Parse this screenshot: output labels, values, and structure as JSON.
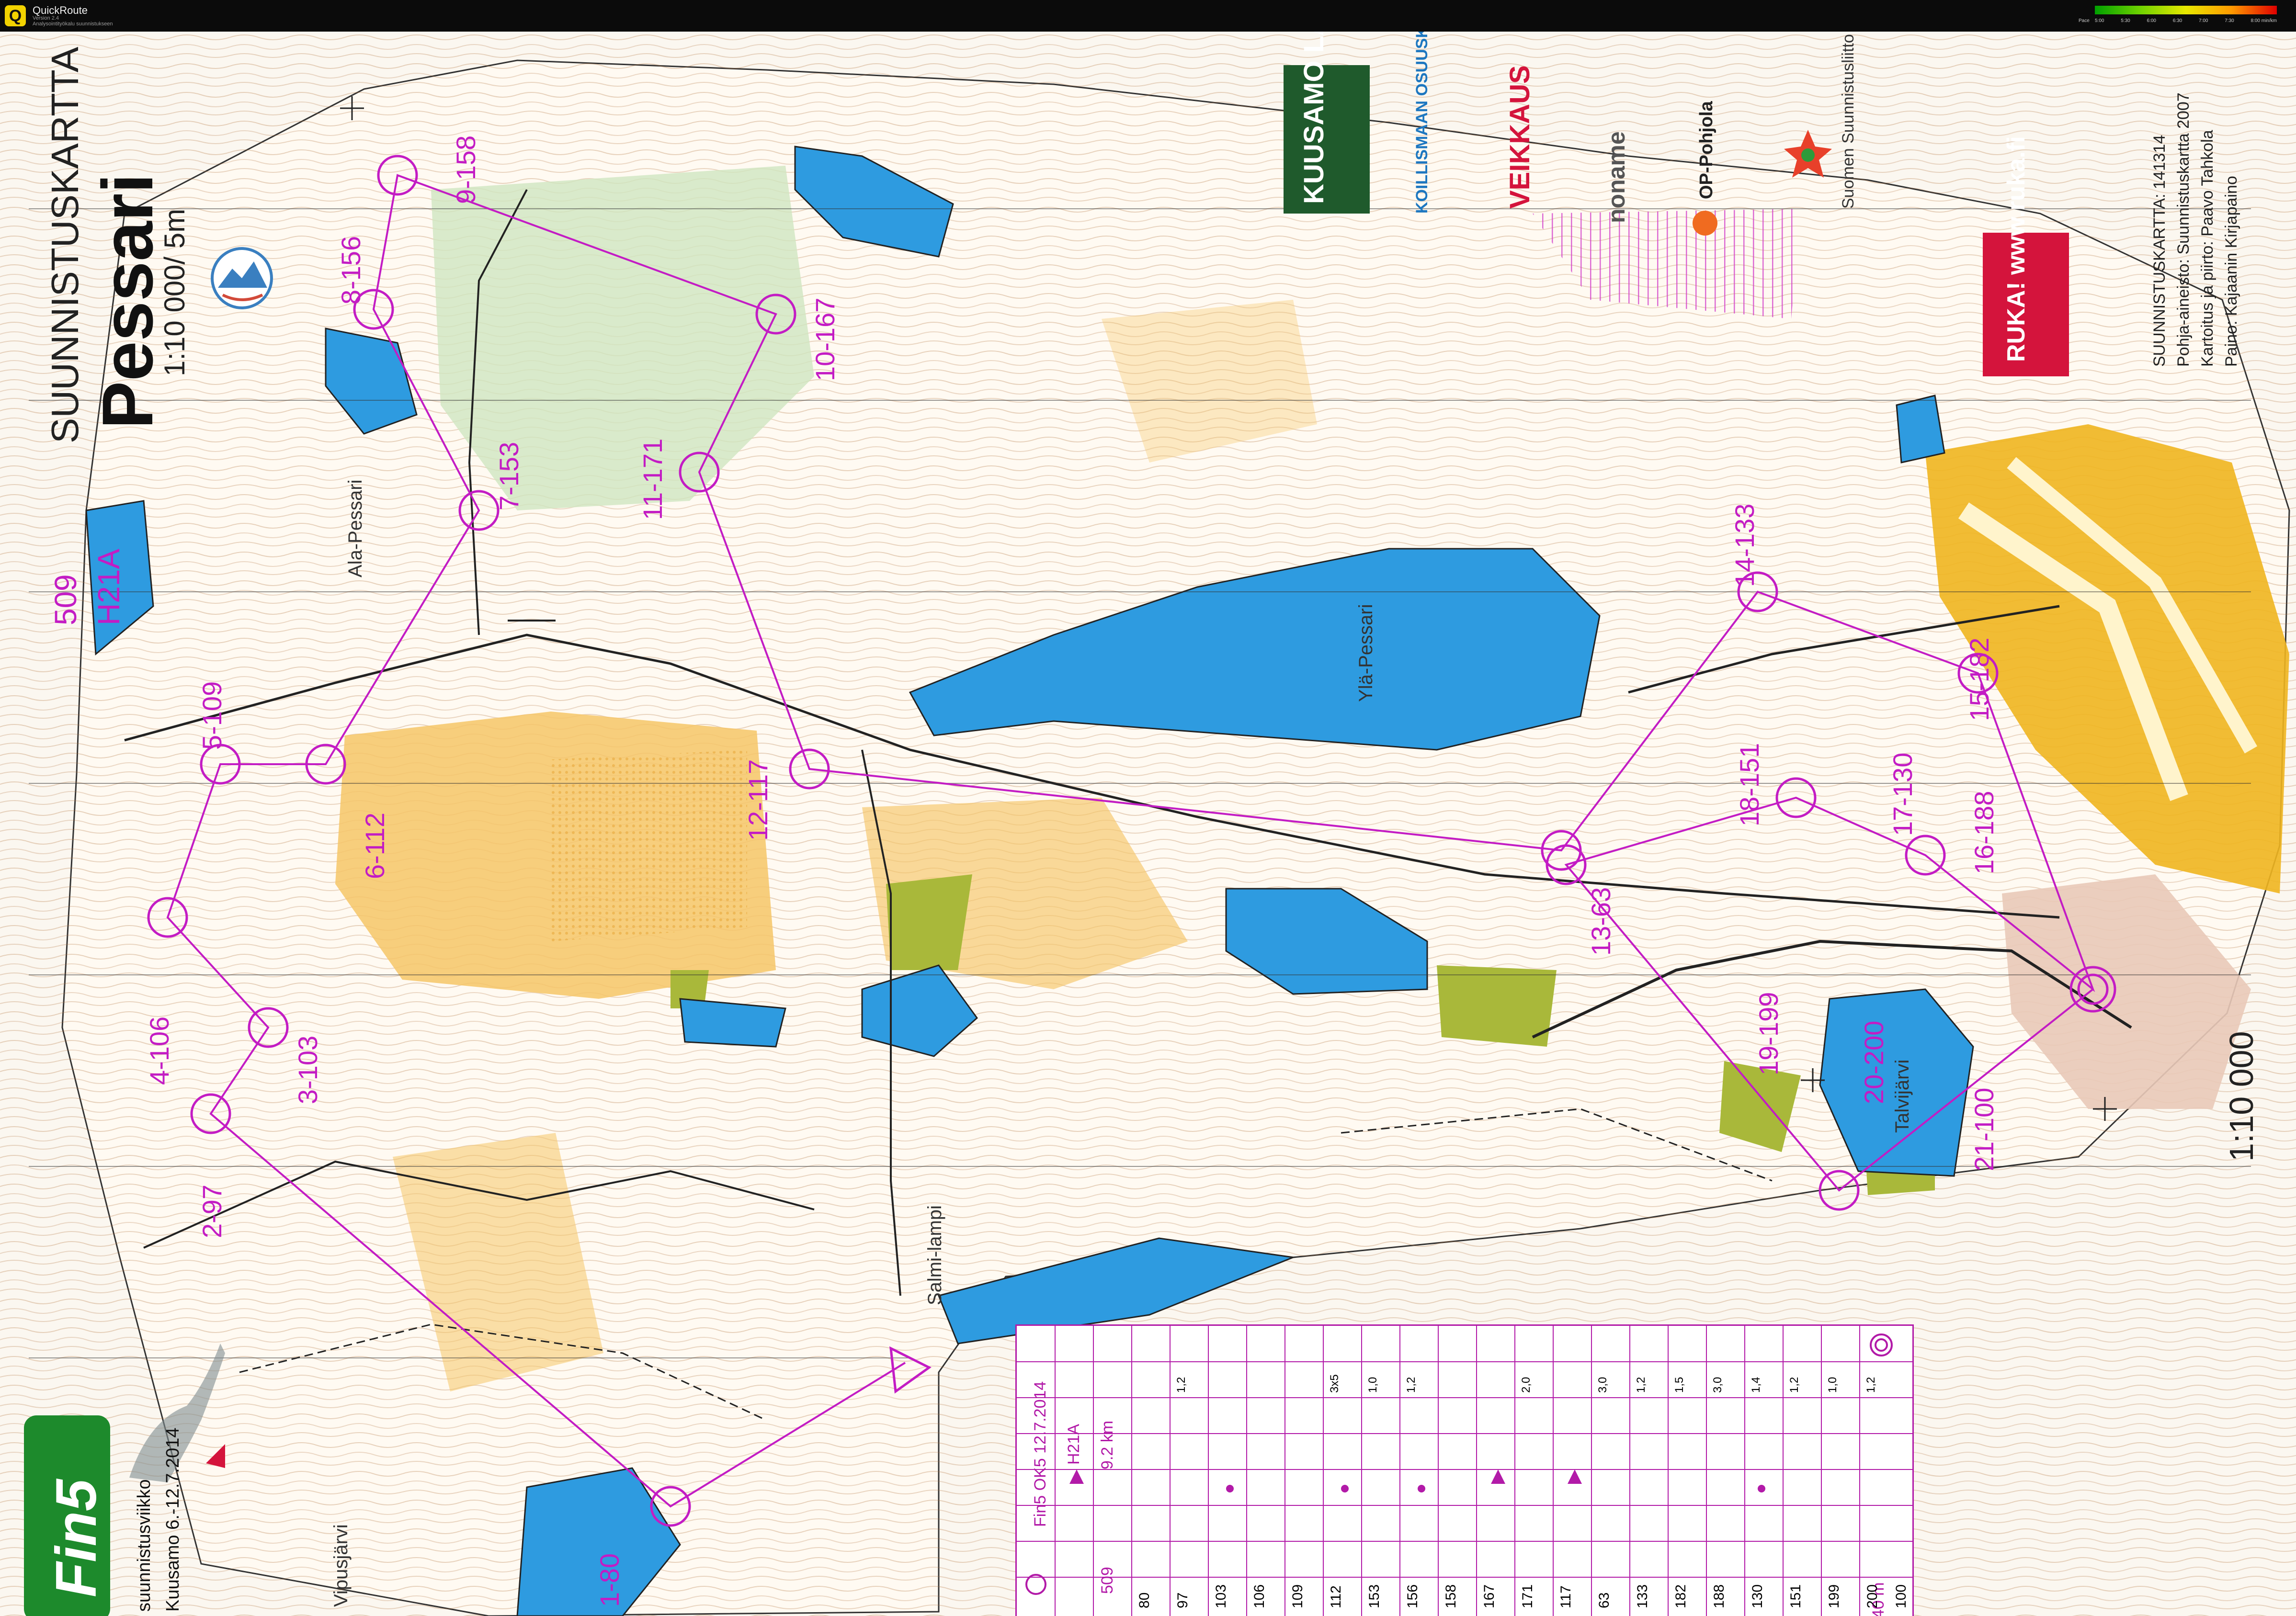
{
  "app": {
    "title": "QuickRoute",
    "subtitle_line1": "Version 2.4",
    "subtitle_line2": "Analysointityökalu suunnistukseen",
    "pace_label": "Pace",
    "pace_ticks": [
      "5:00",
      "5:30",
      "6:00",
      "6:30",
      "7:00",
      "7:30",
      "8:00 min/km"
    ]
  },
  "map": {
    "header": "SUUNNISTUSKARTTA",
    "name": "Pessari",
    "scale": "1:10 000/ 5m",
    "course_number": "509",
    "course_class": "H21A",
    "scale_side": "1:10 000",
    "credits": [
      "SUUNNISTUSKARTTA: 141314",
      "Pohja-aineisto: Suunnistuskartta 2007",
      "Kartoitus ja piirto: Paavo Tahkola",
      "Paino: Kajaanin Kirjapaino"
    ],
    "place_names": [
      "Ala-Pessari",
      "Ylä-Pessari",
      "Talvijärvi",
      "Salmi-lampi",
      "Vipusjärvi"
    ],
    "sponsors": [
      "KUUSAMO LAPLAND",
      "KOILLISMAAN OSUUSKAUPPA",
      "VEIKKAUS",
      "noname",
      "OP-Pohjola",
      "Suomen Suunnistusliitto",
      "RUKA! www.ruka.fi"
    ],
    "controls": [
      {
        "label": "1-80"
      },
      {
        "label": "2-97"
      },
      {
        "label": "3-103"
      },
      {
        "label": "4-106"
      },
      {
        "label": "5-109"
      },
      {
        "label": "6-112"
      },
      {
        "label": "7-153"
      },
      {
        "label": "8-156"
      },
      {
        "label": "9-158"
      },
      {
        "label": "10-167"
      },
      {
        "label": "11-171"
      },
      {
        "label": "12-117"
      },
      {
        "label": "13-63"
      },
      {
        "label": "14-133"
      },
      {
        "label": "15-182"
      },
      {
        "label": "16-188"
      },
      {
        "label": "17-130"
      },
      {
        "label": "18-151"
      },
      {
        "label": "19-199"
      },
      {
        "label": "20-200"
      },
      {
        "label": "21-100"
      }
    ],
    "event": {
      "logo": "Fin5",
      "line1": "suunnistusviikko",
      "line2": "Kuusamo 6.-12.7.2014"
    }
  },
  "description_sheet": {
    "title": "Fin5  OK5 12.7.2014",
    "class": "H21A",
    "course": "509",
    "length": "9.2 km",
    "finish": "140 m",
    "rows": [
      {
        "n": "1",
        "code": "80"
      },
      {
        "n": "2",
        "code": "97"
      },
      {
        "n": "3",
        "code": "103"
      },
      {
        "n": "4",
        "code": "106"
      },
      {
        "n": "5",
        "code": "109"
      },
      {
        "n": "6",
        "code": "112"
      },
      {
        "n": "7",
        "code": "153"
      },
      {
        "n": "8",
        "code": "156"
      },
      {
        "n": "9",
        "code": "158"
      },
      {
        "n": "10",
        "code": "167"
      },
      {
        "n": "11",
        "code": "171"
      },
      {
        "n": "12",
        "code": "117"
      },
      {
        "n": "13",
        "code": "63"
      },
      {
        "n": "14",
        "code": "133"
      },
      {
        "n": "15",
        "code": "182"
      },
      {
        "n": "16",
        "code": "188"
      },
      {
        "n": "17",
        "code": "130"
      },
      {
        "n": "18",
        "code": "151"
      },
      {
        "n": "19",
        "code": "199"
      },
      {
        "n": "20",
        "code": "200"
      },
      {
        "n": "21",
        "code": "100"
      }
    ],
    "dims": [
      "1,2",
      "3x5",
      "1,0",
      "1,2",
      "2,0",
      "3,0",
      "1,2",
      "1,5",
      "3,0",
      "1,4",
      "1,2",
      "1,0",
      "1,2"
    ]
  },
  "colors": {
    "course": "#c31cc4",
    "water": "#2e9be0",
    "open": "#f6c667",
    "green": "#a9d06e",
    "contour": "#b0703a",
    "ski": "#f0b51f"
  }
}
